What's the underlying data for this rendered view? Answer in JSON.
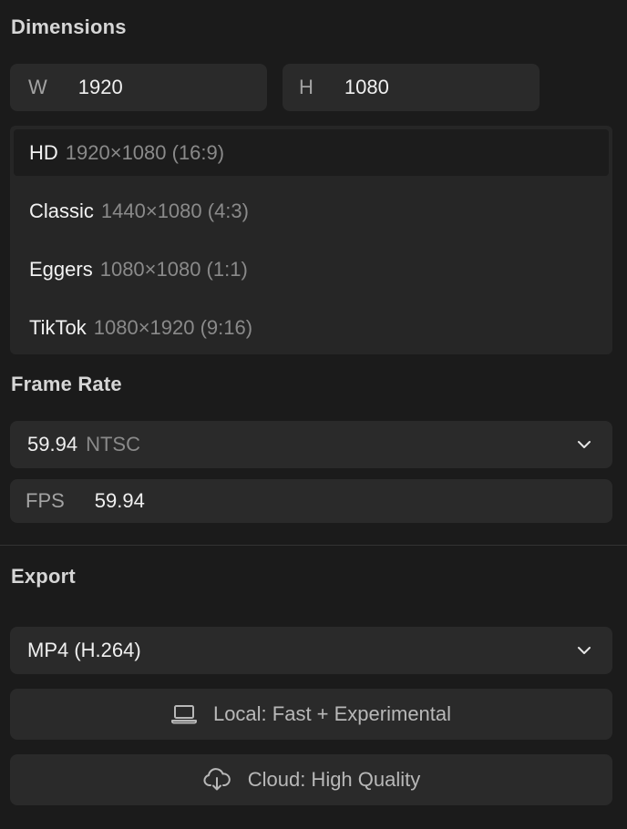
{
  "dimensions": {
    "title": "Dimensions",
    "width_label": "W",
    "width_value": "1920",
    "height_label": "H",
    "height_value": "1080"
  },
  "presets": [
    {
      "name": "HD",
      "spec": "1920×1080 (16:9)",
      "selected": true
    },
    {
      "name": "Classic",
      "spec": "1440×1080 (4:3)",
      "selected": false
    },
    {
      "name": "Eggers",
      "spec": "1080×1080 (1:1)",
      "selected": false
    },
    {
      "name": "TikTok",
      "spec": "1080×1920 (9:16)",
      "selected": false
    }
  ],
  "frame_rate": {
    "title": "Frame Rate",
    "selected_value": "59.94",
    "selected_suffix": "NTSC",
    "fps_label": "FPS",
    "fps_value": "59.94"
  },
  "export": {
    "title": "Export",
    "format": "MP4 (H.264)",
    "local_button": "Local: Fast + Experimental",
    "cloud_button": "Cloud: High Quality"
  },
  "icons": {
    "dropdown": "chevron-down-icon",
    "local": "laptop-icon",
    "cloud": "cloud-download-icon"
  },
  "colors": {
    "background": "#1b1b1b",
    "field": "#2a2a2a",
    "muted_text": "#8a8a8a"
  }
}
